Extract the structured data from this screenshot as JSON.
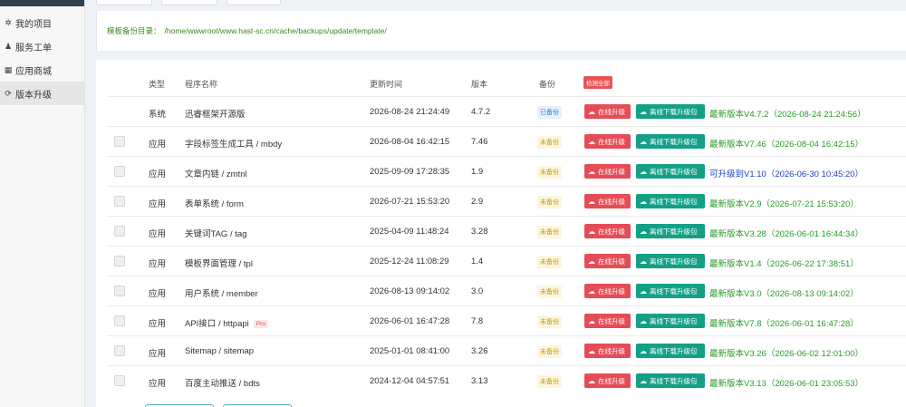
{
  "sidebar": {
    "items": [
      {
        "label": "我的项目",
        "icon": "gear-icon",
        "glyph": "✲"
      },
      {
        "label": "服务工单",
        "icon": "user-icon",
        "glyph": "♟"
      },
      {
        "label": "应用商城",
        "icon": "store-icon",
        "glyph": "▦"
      },
      {
        "label": "版本升级",
        "icon": "refresh-icon",
        "glyph": "⟳",
        "active": true
      }
    ]
  },
  "path": {
    "label": "模板备份目录：",
    "value": "/home/wwwroot/www.hast-sc.cn/cache/backups/update/template/"
  },
  "table": {
    "headers": {
      "type": "类型",
      "name": "程序名称",
      "time": "更新时间",
      "version": "版本",
      "backup": "备份"
    },
    "detect_all": "检测全部",
    "online_label": "在线升级",
    "offline_label": "离线下载升级包",
    "rows": [
      {
        "checkbox": false,
        "type": "系统",
        "name": "迅睿框架开源版",
        "pro": "",
        "time": "2026-08-24 21:24:49",
        "version": "4.7.2",
        "backup": "已备份",
        "backup_state": "done",
        "status": "最新版本V4.7.2（2026-08-24 21:24:56）",
        "status_kind": "latest"
      },
      {
        "checkbox": true,
        "type": "应用",
        "name": "字段标签生成工具 / mbdy",
        "pro": "",
        "time": "2026-08-04 16:42:15",
        "version": "7.46",
        "backup": "未备份",
        "backup_state": "none",
        "status": "最新版本V7.46（2026-08-04 16:42:15）",
        "status_kind": "latest"
      },
      {
        "checkbox": true,
        "type": "应用",
        "name": "文章内链 / zmtnl",
        "pro": "",
        "time": "2025-09-09 17:28:35",
        "version": "1.9",
        "backup": "未备份",
        "backup_state": "none",
        "status": "可升级到V1.10（2026-06-30 10:45:20）",
        "status_kind": "upgrade"
      },
      {
        "checkbox": true,
        "type": "应用",
        "name": "表单系统 / form",
        "pro": "",
        "time": "2026-07-21 15:53:20",
        "version": "2.9",
        "backup": "未备份",
        "backup_state": "none",
        "status": "最新版本V2.9（2026-07-21 15:53:20）",
        "status_kind": "latest"
      },
      {
        "checkbox": true,
        "type": "应用",
        "name": "关键词TAG / tag",
        "pro": "",
        "time": "2025-04-09 11:48:24",
        "version": "3.28",
        "backup": "未备份",
        "backup_state": "none",
        "status": "最新版本V3.28（2026-06-01 16:44:34）",
        "status_kind": "latest"
      },
      {
        "checkbox": true,
        "type": "应用",
        "name": "模板界面管理 / tpl",
        "pro": "",
        "time": "2025-12-24 11:08:29",
        "version": "1.4",
        "backup": "未备份",
        "backup_state": "none",
        "status": "最新版本V1.4（2026-06-22 17:38:51）",
        "status_kind": "latest"
      },
      {
        "checkbox": true,
        "type": "应用",
        "name": "用户系统 / member",
        "pro": "",
        "time": "2026-08-13 09:14:02",
        "version": "3.0",
        "backup": "未备份",
        "backup_state": "none",
        "status": "最新版本V3.0（2026-08-13 09:14:02）",
        "status_kind": "latest"
      },
      {
        "checkbox": true,
        "type": "应用",
        "name": "API接口 / httpapi",
        "pro": "Pro",
        "time": "2026-06-01 16:47:28",
        "version": "7.8",
        "backup": "未备份",
        "backup_state": "none",
        "status": "最新版本V7.8（2026-06-01 16:47:28）",
        "status_kind": "latest"
      },
      {
        "checkbox": true,
        "type": "应用",
        "name": "Sitemap / sitemap",
        "pro": "",
        "time": "2025-01-01 08:41:00",
        "version": "3.26",
        "backup": "未备份",
        "backup_state": "none",
        "status": "最新版本V3.26（2026-06-02 12:01:00）",
        "status_kind": "latest"
      },
      {
        "checkbox": true,
        "type": "应用",
        "name": "百度主动推送 / bdts",
        "pro": "",
        "time": "2024-12-04 04:57:51",
        "version": "3.13",
        "backup": "未备份",
        "backup_state": "none",
        "status": "最新版本V3.13（2026-06-01 23:05:53）",
        "status_kind": "latest"
      }
    ]
  }
}
